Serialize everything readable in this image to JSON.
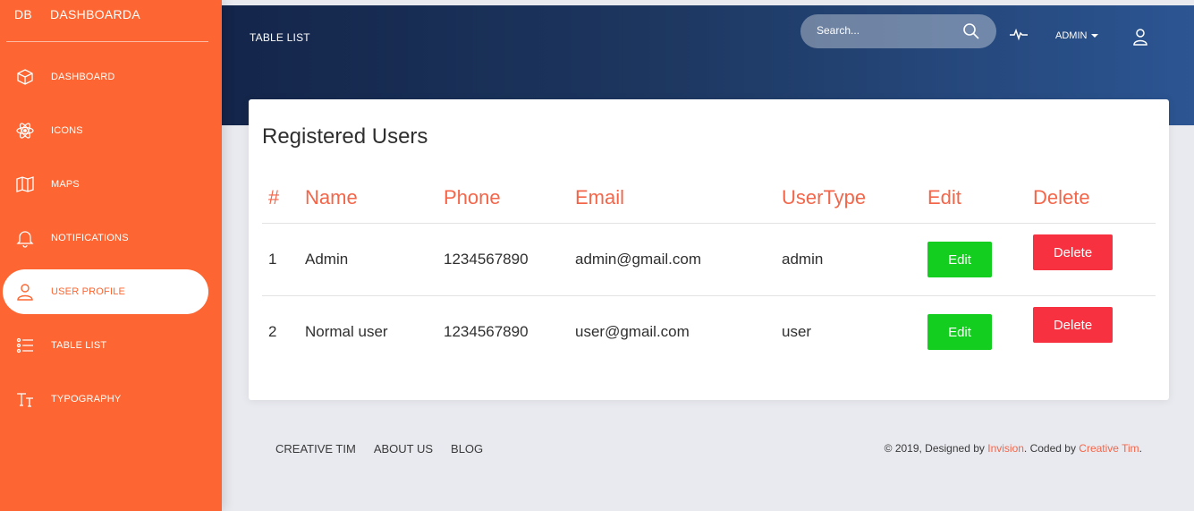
{
  "brand": {
    "mini": "DB",
    "name": "DASHBOARDA"
  },
  "sidebar": {
    "items": [
      {
        "label": "DASHBOARD",
        "icon": "cube-icon",
        "active": false
      },
      {
        "label": "ICONS",
        "icon": "atom-icon",
        "active": false
      },
      {
        "label": "MAPS",
        "icon": "map-icon",
        "active": false
      },
      {
        "label": "NOTIFICATIONS",
        "icon": "bell-icon",
        "active": false
      },
      {
        "label": "USER PROFILE",
        "icon": "user-icon",
        "active": true
      },
      {
        "label": "TABLE LIST",
        "icon": "list-icon",
        "active": false
      },
      {
        "label": "TYPOGRAPHY",
        "icon": "text-icon",
        "active": false
      }
    ]
  },
  "header": {
    "page_label": "TABLE LIST",
    "search_placeholder": "Search...",
    "user_menu": "ADMIN"
  },
  "card": {
    "title": "Registered Users",
    "columns": [
      "#",
      "Name",
      "Phone",
      "Email",
      "UserType",
      "Edit",
      "Delete"
    ],
    "rows": [
      {
        "num": "1",
        "name": "Admin",
        "phone": "1234567890",
        "email": "admin@gmail.com",
        "type": "admin",
        "edit": "Edit",
        "delete": "Delete"
      },
      {
        "num": "2",
        "name": "Normal user",
        "phone": "1234567890",
        "email": "user@gmail.com",
        "type": "user",
        "edit": "Edit",
        "delete": "Delete"
      }
    ]
  },
  "footer": {
    "links": [
      "CREATIVE TIM",
      "ABOUT US",
      "BLOG"
    ],
    "copyright_prefix": "© 2019, Designed by ",
    "designer": "Invision",
    "copyright_mid": ". Coded by ",
    "coder": "Creative Tim",
    "copyright_suffix": "."
  },
  "colors": {
    "sidebar": "#fd6632",
    "accent": "#f4664a",
    "edit_button": "#13ce1e",
    "delete_button": "#f7313f",
    "header_start": "#14254a",
    "header_end": "#2c5592"
  }
}
